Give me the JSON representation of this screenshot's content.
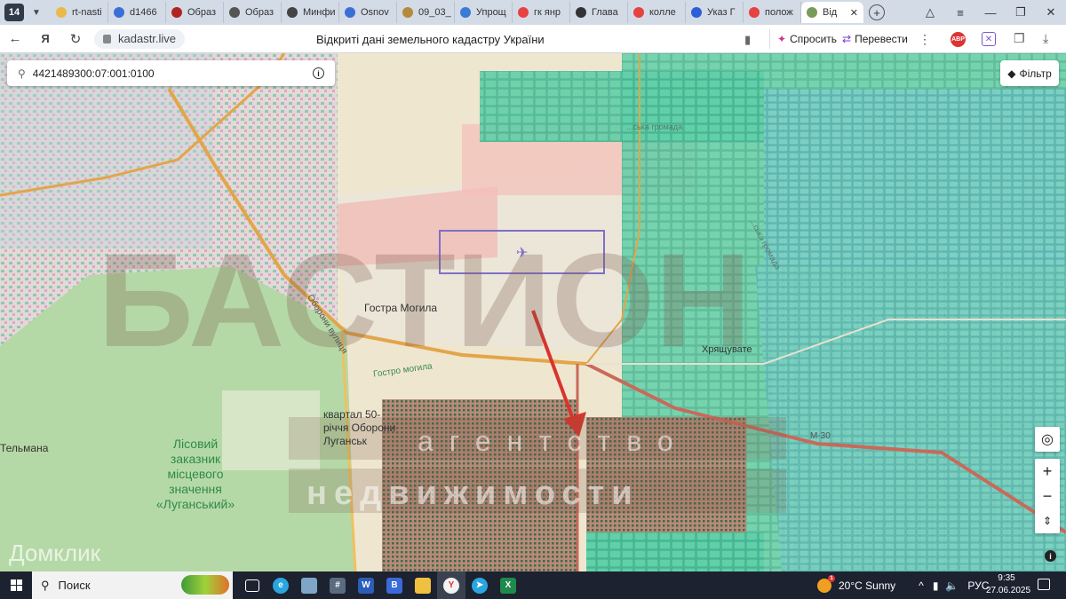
{
  "browser": {
    "tab_count": "14",
    "tabs": [
      {
        "label": "rt-nasti",
        "color": "#e9b949"
      },
      {
        "label": "d1466",
        "color": "#3b6fd8"
      },
      {
        "label": "Образ",
        "color": "#b02323"
      },
      {
        "label": "Образ",
        "color": "#555555"
      },
      {
        "label": "Минфи",
        "color": "#444444"
      },
      {
        "label": "Osnov",
        "color": "#3b6fd8"
      },
      {
        "label": "09_03_",
        "color": "#b48a3c"
      },
      {
        "label": "Упрощ",
        "color": "#3a7bd5"
      },
      {
        "label": "гк янр",
        "color": "#e84141"
      },
      {
        "label": "Глава",
        "color": "#333333"
      },
      {
        "label": "колле",
        "color": "#e84141"
      },
      {
        "label": "Указ Г",
        "color": "#2c5fd8"
      },
      {
        "label": "полож",
        "color": "#e84141"
      },
      {
        "label": "Від",
        "color": "#7a9a5a"
      }
    ],
    "url": "kadastr.live",
    "page_title": "Відкриті дані земельного кадастру України",
    "ask_label": "Спросить",
    "translate_label": "Перевести",
    "abp_label": "ABP"
  },
  "map": {
    "search_value": "4421489300:07:001:0100",
    "filter_label": "Фільтр",
    "labels": {
      "hromada_top": "...ська громада",
      "hromada_right": "...ська громада",
      "gostra_mogyla": "Гостра Могила",
      "gostro_mogyla_small": "Гостро могила",
      "kvartal": "квартал 50-річчя Оборони Луганська",
      "kvartal_line1": "квартал 50-",
      "kvartal_line2": "річчя Оборони",
      "kvartal_line3": "Луганськ",
      "khryashchuvate": "Хрящувате",
      "telmana": "Тельмана",
      "reserve": "Лісовий заказник місцевого значення «Луганський»",
      "reserve_line1": "Лісовий",
      "reserve_line2": "заказник",
      "reserve_line3": "місцевого",
      "reserve_line4": "значення",
      "reserve_line5": "«Луганський»",
      "road_m30": "М-30",
      "street_oborony": "Оборони вулиця",
      "watermark_main": "БАСТИОН",
      "watermark_sub1": "агентство",
      "watermark_sub2": "недвижимости",
      "watermark_domclick": "Домклик"
    }
  },
  "taskbar": {
    "search_placeholder": "Поиск",
    "weather": "20°C  Sunny",
    "weather_badge": "1",
    "lang": "РУС",
    "time": "9:35",
    "date": "27.06.2025"
  }
}
